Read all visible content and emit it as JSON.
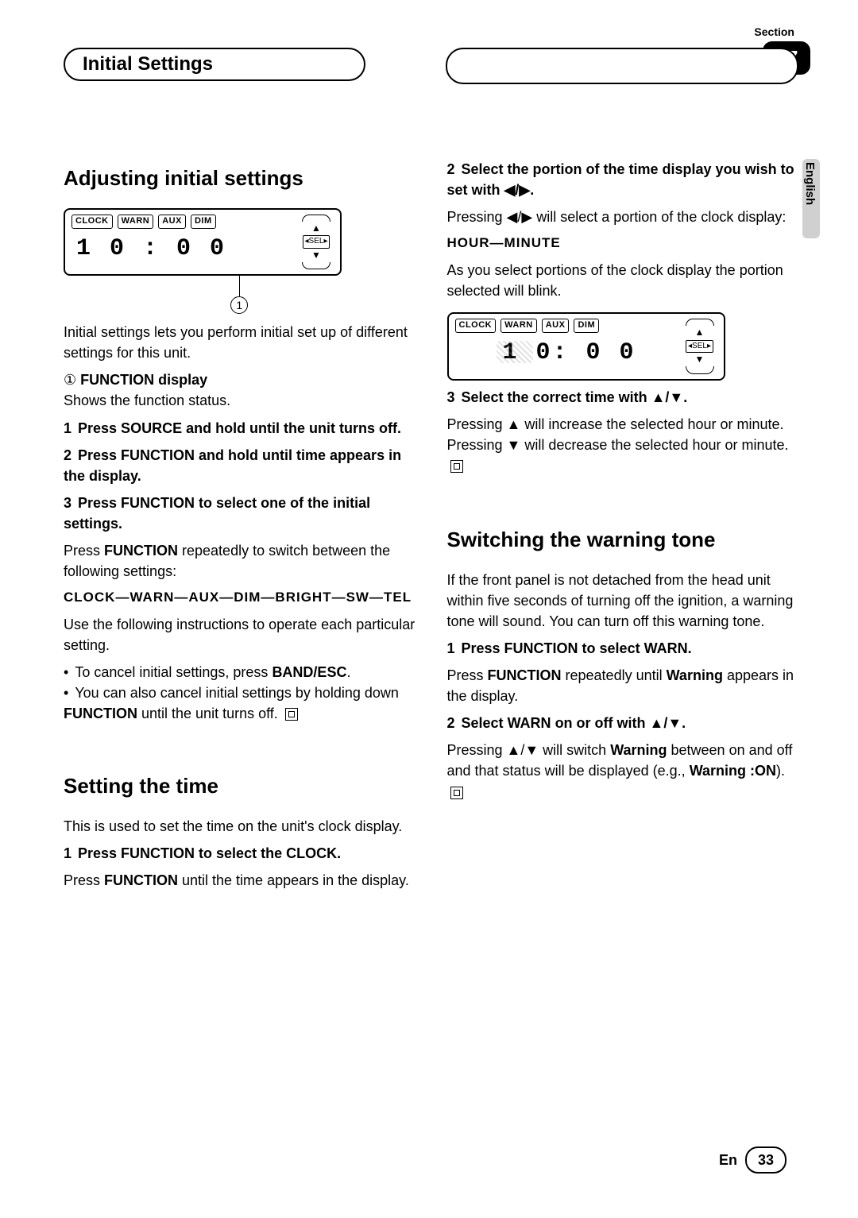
{
  "header": {
    "section_word": "Section",
    "section_number": "07",
    "title": "Initial Settings",
    "language_tab": "English"
  },
  "left": {
    "h1": "Adjusting initial settings",
    "lcd1": {
      "tabs": [
        "CLOCK",
        "WARN",
        "AUX",
        "DIM"
      ],
      "time": "1 0 : 0 0",
      "sel": "SEL"
    },
    "callout_num": "1",
    "intro": "Initial settings lets you perform initial set up of different settings for this unit.",
    "fn_label_num": "①",
    "fn_label_title": "FUNCTION display",
    "fn_label_desc": "Shows the function status.",
    "step1_n": "1",
    "step1_b": "Press SOURCE and hold until the unit turns off.",
    "step2_n": "2",
    "step2_b": "Press FUNCTION and hold until time appears in the display.",
    "step3_n": "3",
    "step3_b": "Press FUNCTION to select one of the initial settings.",
    "step3_p1a": "Press ",
    "step3_p1b": "FUNCTION",
    "step3_p1c": " repeatedly to switch between the following settings:",
    "seq": "CLOCK—WARN—AUX—DIM—BRIGHT—SW—TEL",
    "step3_use": "Use the following instructions to operate each particular setting.",
    "bul1a": "To cancel initial settings, press ",
    "bul1b": "BAND/ESC",
    "bul1c": ".",
    "bul2a": "You can also cancel initial settings by holding down ",
    "bul2b": "FUNCTION",
    "bul2c": " until the unit turns off.",
    "h2": "Setting the time",
    "time_intro": "This is used to set the time on the unit's clock display.",
    "time_s1_n": "1",
    "time_s1_ba": "Press FUNCTION to select the ",
    "time_s1_bb": "CLOCK",
    "time_s1_bc": ".",
    "time_s1_pa": "Press ",
    "time_s1_pb": "FUNCTION",
    "time_s1_pc": " until the time appears in the display."
  },
  "right": {
    "s2_n": "2",
    "s2_b": "Select the portion of the time display you wish to set with ◀/▶.",
    "s2_p": "Pressing ◀/▶ will select a portion of the clock display:",
    "hm": "HOUR—MINUTE",
    "s2_p2": "As you select portions of the clock display the portion selected will blink.",
    "lcd2": {
      "tabs": [
        "CLOCK",
        "WARN",
        "AUX",
        "DIM"
      ],
      "time_h": "1 0",
      "time_m": ": 0 0",
      "sel": "SEL"
    },
    "s3_n": "3",
    "s3_b": "Select the correct time with ▲/▼.",
    "s3_p": "Pressing ▲ will increase the selected hour or minute. Pressing ▼ will decrease the selected hour or minute.",
    "h3": "Switching the warning tone",
    "warn_intro": "If the front panel is not detached from the head unit within five seconds of turning off the ignition, a warning tone will sound. You can turn off this warning tone.",
    "w1_n": "1",
    "w1_ba": "Press FUNCTION to select ",
    "w1_bb": "WARN",
    "w1_bc": ".",
    "w1_pa": "Press ",
    "w1_pb": "FUNCTION",
    "w1_pc": " repeatedly until ",
    "w1_pd": "Warning",
    "w1_pe": " appears in the display.",
    "w2_n": "2",
    "w2_ba": "Select ",
    "w2_bb": "WARN",
    "w2_bc": " on or off with ▲/▼.",
    "w2_pa": "Pressing ▲/▼ will switch ",
    "w2_pb": "Warning",
    "w2_pc": " between on and off and that status will be displayed (e.g., ",
    "w2_pd": "Warning :ON",
    "w2_pe": ")."
  },
  "footer": {
    "lang": "En",
    "page": "33"
  }
}
